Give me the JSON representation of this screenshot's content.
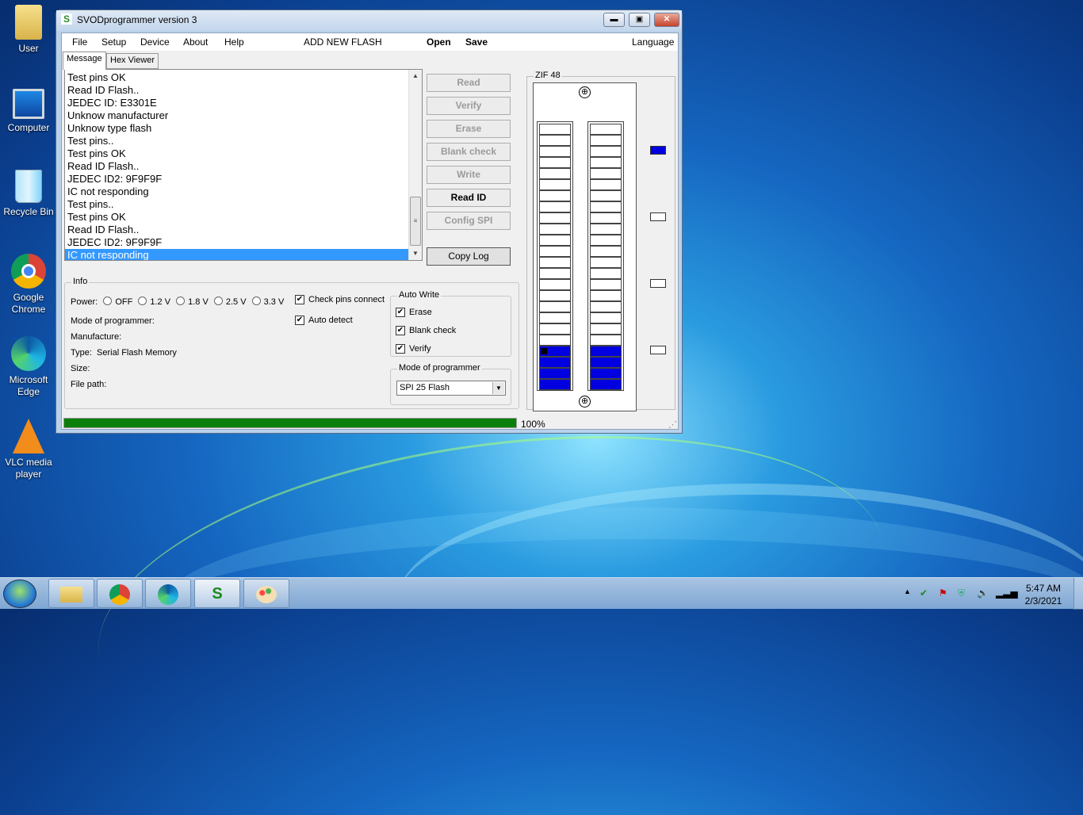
{
  "window": {
    "title": "SVODprogrammer version 3",
    "app_icon_glyph": "S",
    "minimize_glyph": "▬",
    "maximize_glyph": "▣",
    "close_glyph": "✕"
  },
  "menu": {
    "file": "File",
    "setup": "Setup",
    "device": "Device",
    "about": "About",
    "help": "Help",
    "add_new_flash": "ADD NEW FLASH",
    "open": "Open",
    "save": "Save",
    "language": "Language"
  },
  "tabs": {
    "message": "Message",
    "hex_viewer": "Hex Viewer"
  },
  "log": {
    "lines": [
      "Test pins OK",
      "Read ID Flash..",
      "JEDEC ID: E3301E",
      "Unknow manufacturer",
      "Unknow type flash",
      "Test pins..",
      "Test pins OK",
      "Read ID Flash..",
      "JEDEC ID2: 9F9F9F",
      "IC not responding",
      "Test pins..",
      "Test pins OK",
      "Read ID Flash..",
      "JEDEC ID2: 9F9F9F",
      "IC not responding"
    ],
    "scroll_up": "▲",
    "scroll_down": "▼",
    "thumb_grip": "≡"
  },
  "actions": {
    "read": "Read",
    "verify": "Verify",
    "erase": "Erase",
    "blank_check": "Blank check",
    "write": "Write",
    "read_id": "Read ID",
    "config_spi": "Config SPI",
    "copy_log": "Copy Log"
  },
  "info": {
    "group_label": "Info",
    "power_label": "Power:",
    "power_options": [
      "OFF",
      "1.2 V",
      "1.8 V",
      "2.5 V",
      "3.3 V"
    ],
    "check_pins_connect": "Check pins connect",
    "auto_detect": "Auto detect",
    "mode_of_programmer_label": "Mode of programmer:",
    "manufacture_label": "Manufacture:",
    "type_label": "Type:",
    "type_value": "Serial Flash Memory",
    "size_label": "Size:",
    "file_path_label": "File path:",
    "checkmark": "✔"
  },
  "auto_write": {
    "group_label": "Auto Write",
    "erase": "Erase",
    "blank_check": "Blank check",
    "verify": "Verify"
  },
  "mode_group": {
    "group_label": "Mode of programmer",
    "selected": "SPI 25 Flash",
    "arrow": "▼"
  },
  "zif": {
    "label": "ZIF 48",
    "pins_per_side": 24,
    "blue_pins_from_bottom": 4,
    "cross_glyph": "⊕"
  },
  "progress": {
    "value": 1.0,
    "label": "100%",
    "color": "#0a800a"
  },
  "desktop_icons": [
    {
      "name": "User"
    },
    {
      "name": "Computer"
    },
    {
      "name": "Recycle Bin"
    },
    {
      "name": "Google Chrome"
    },
    {
      "name": "Microsoft Edge"
    },
    {
      "name": "VLC media player"
    }
  ],
  "taskbar": {
    "apps": [
      "file-explorer-icon",
      "chrome-icon",
      "edge-icon",
      "svod-icon",
      "paint-icon"
    ],
    "time": "5:47 AM",
    "date": "2/3/2021"
  }
}
